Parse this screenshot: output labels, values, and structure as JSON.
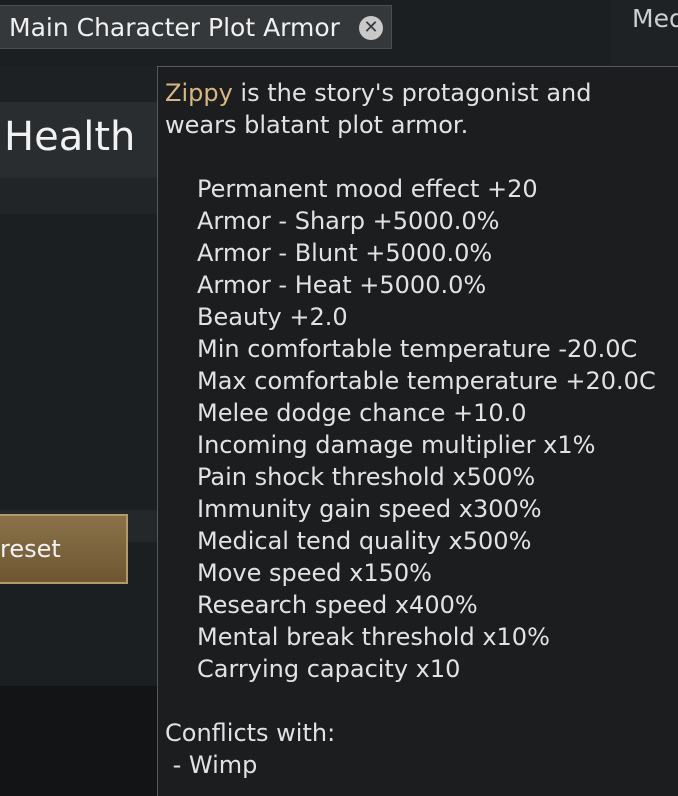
{
  "tab": {
    "title": "Main Character Plot Armor",
    "close_glyph": "✕"
  },
  "right_header": {
    "label": "Med"
  },
  "left_panel": {
    "health_label": "Health",
    "reset_label": "reset"
  },
  "tooltip": {
    "name": "Zippy",
    "intro_suffix": " is the story's protagonist and wears blatant plot armor.",
    "effects": [
      "Permanent mood effect +20",
      "Armor - Sharp +5000.0%",
      "Armor - Blunt +5000.0%",
      "Armor - Heat +5000.0%",
      "Beauty +2.0",
      "Min comfortable temperature -20.0C",
      "Max comfortable temperature +20.0C",
      "Melee dodge chance +10.0",
      "Incoming damage multiplier x1%",
      "Pain shock threshold x500%",
      "Immunity gain speed x300%",
      "Medical tend quality x500%",
      "Move speed x150%",
      "Research speed x400%",
      "Mental break threshold x10%",
      "Carrying capacity x10"
    ],
    "conflicts_heading": "Conflicts with:",
    "conflicts": [
      " - Wimp"
    ]
  },
  "colors": {
    "name_accent": "#d8b683",
    "reset_button": "#7b6340",
    "tooltip_bg": "#1b1d1f"
  }
}
